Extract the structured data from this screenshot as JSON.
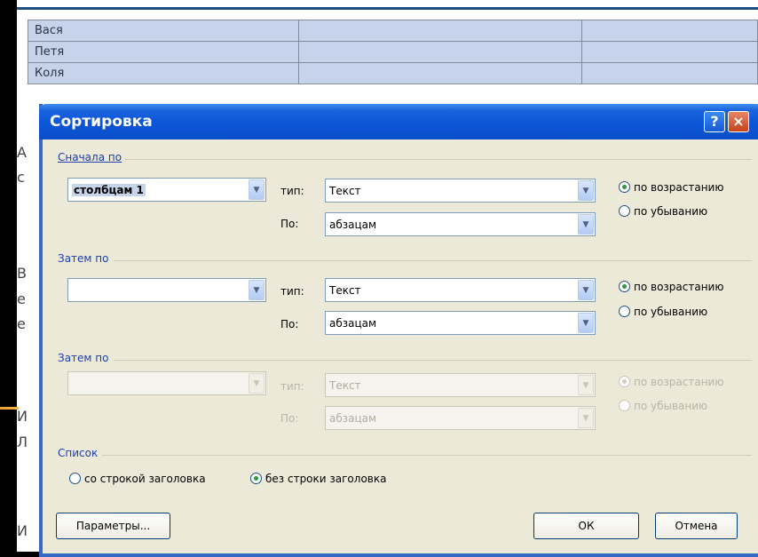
{
  "document": {
    "table_rows": [
      {
        "name": "Вася"
      },
      {
        "name": "Петя"
      },
      {
        "name": "Коля"
      }
    ],
    "left_fragments": [
      "А",
      "с",
      "В",
      "е",
      "е",
      "И",
      "Л",
      "И"
    ]
  },
  "dialog": {
    "title": "Сортировка",
    "help_glyph": "?",
    "close_glyph": "×",
    "first_group": {
      "title": "Сначала по",
      "column_value": "столбцам 1",
      "type_label": "тип:",
      "type_value": "Текст",
      "by_label": "По:",
      "by_value": "абзацам",
      "asc_label": "по возрастанию",
      "desc_label": "по убыванию",
      "selected": "asc"
    },
    "second_group": {
      "title": "Затем по",
      "column_value": "",
      "type_label": "тип:",
      "type_value": "Текст",
      "by_label": "По:",
      "by_value": "абзацам",
      "asc_label": "по возрастанию",
      "desc_label": "по убыванию",
      "selected": "asc"
    },
    "third_group": {
      "title": "Затем по",
      "column_value": "",
      "type_label": "тип:",
      "type_value": "Текст",
      "by_label": "По:",
      "by_value": "абзацам",
      "asc_label": "по возрастанию",
      "desc_label": "по убыванию",
      "selected": "asc",
      "disabled": true
    },
    "list_group": {
      "title": "Список",
      "with_header_label": "со строкой заголовка",
      "without_header_label": "без строки заголовка",
      "selected": "without_header"
    },
    "buttons": {
      "options_label": "Параметры...",
      "ok_label": "ОК",
      "cancel_label": "Отмена"
    }
  },
  "colors": {
    "title_bar": "#0b55d7",
    "table_cell": "#c6d3ea",
    "dialog_face": "#ece9d8",
    "group_title": "#1d3fa8"
  }
}
